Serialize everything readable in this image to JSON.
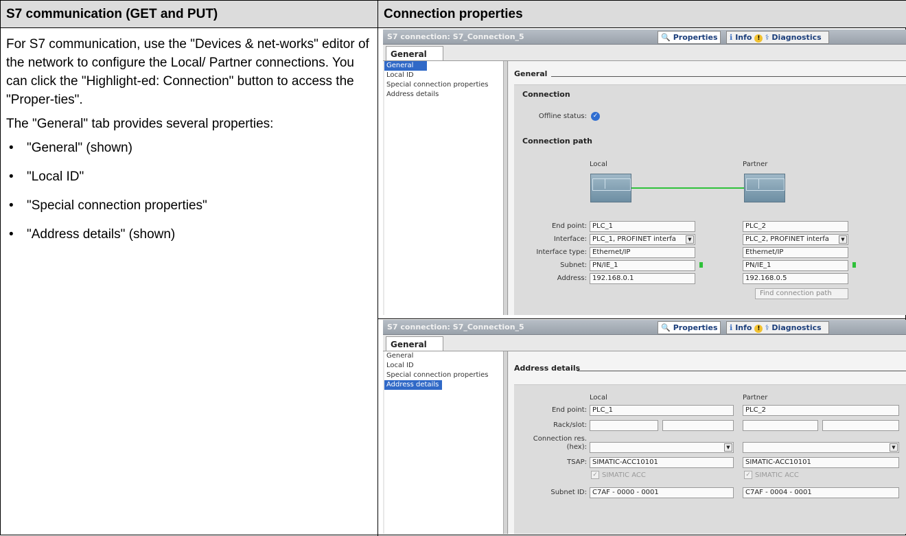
{
  "table": {
    "header_left": "S7 communication (GET and PUT)",
    "header_right": "Connection properties"
  },
  "description": {
    "p1": "For S7 communication, use the \"Devices & net-works\" editor of the network to configure the Local/ Partner connections. You can click the \"Highlight-ed: Connection\" button to access the \"Proper-ties\".",
    "p2": "The \"General\" tab provides several properties:",
    "bullets": [
      "\"General\" (shown)",
      "\"Local ID\"",
      "\"Special connection properties\"",
      "\"Address details\" (shown)"
    ]
  },
  "panel_common": {
    "title": "S7 connection: S7_Connection_5",
    "tab_properties": "Properties",
    "tab_info": "Info",
    "tab_diagnostics": "Diagnostics",
    "general_tab": "General",
    "nav": [
      "General",
      "Local ID",
      "Special connection properties",
      "Address details"
    ]
  },
  "panel1": {
    "section": "General",
    "group_connection": "Connection",
    "offline_status_label": "Offline status:",
    "group_path": "Connection path",
    "col_local": "Local",
    "col_partner": "Partner",
    "rows": {
      "end_point_label": "End point:",
      "end_point_local": "PLC_1",
      "end_point_partner": "PLC_2",
      "interface_label": "Interface:",
      "interface_local": "PLC_1, PROFINET interfa",
      "interface_partner": "PLC_2, PROFINET interfa",
      "interface_type_label": "Interface type:",
      "interface_type_local": "Ethernet/IP",
      "interface_type_partner": "Ethernet/IP",
      "subnet_label": "Subnet:",
      "subnet_local": "PN/IE_1",
      "subnet_partner": "PN/IE_1",
      "address_label": "Address:",
      "address_local": "192.168.0.1",
      "address_partner": "192.168.0.5"
    },
    "find_button": "Find connection path"
  },
  "panel2": {
    "section": "Address details",
    "col_local": "Local",
    "col_partner": "Partner",
    "end_point_label": "End point:",
    "end_point_local": "PLC_1",
    "end_point_partner": "PLC_2",
    "rack_slot_label": "Rack/slot:",
    "conn_res_label_1": "Connection res.",
    "conn_res_label_2": "(hex):",
    "tsap_label": "TSAP:",
    "tsap_local": "SIMATIC-ACC10101",
    "tsap_partner": "SIMATIC-ACC10101",
    "simatic_acc": "SIMATIC ACC",
    "subnet_id_label": "Subnet ID:",
    "subnet_id_local": "C7AF - 0000 - 0001",
    "subnet_id_partner": "C7AF - 0004 - 0001"
  }
}
